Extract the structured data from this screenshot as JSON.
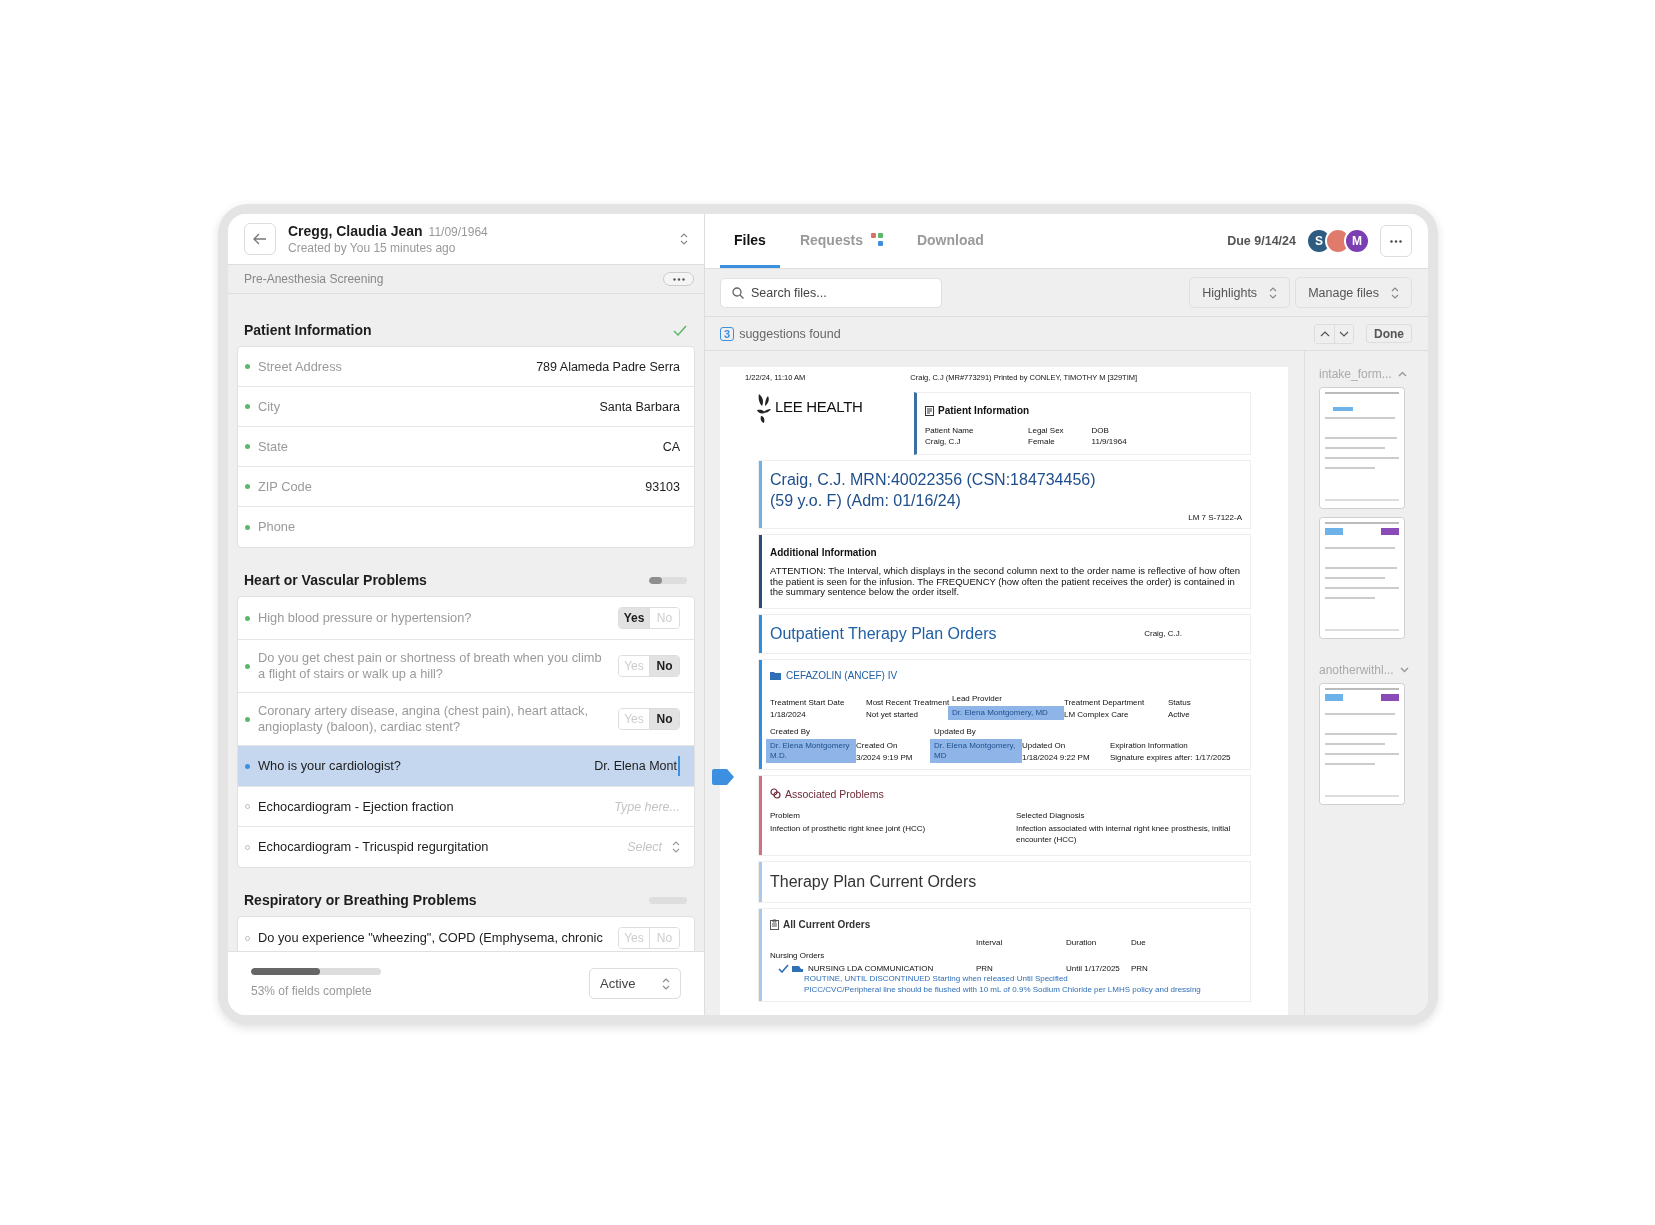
{
  "form": {
    "patient_name": "Cregg, Claudia Jean",
    "dob": "11/09/1964",
    "created": "Created by You 15 minutes ago",
    "form_name": "Pre-Anesthesia Screening",
    "sections": [
      {
        "title": "Patient Information",
        "complete": true,
        "fields": [
          {
            "kind": "text",
            "label": "Street Address",
            "value": "789 Alameda Padre Serra",
            "answered": true,
            "selected": false
          },
          {
            "kind": "text",
            "label": "City",
            "value": "Santa Barbara",
            "answered": true,
            "selected": false
          },
          {
            "kind": "text",
            "label": "State",
            "value": "CA",
            "answered": true,
            "selected": false
          },
          {
            "kind": "text",
            "label": "ZIP Code",
            "value": "93103",
            "answered": true,
            "selected": false
          },
          {
            "kind": "text",
            "label": "Phone",
            "answered": true,
            "selected": false
          }
        ]
      },
      {
        "title": "Heart or Vascular Problems",
        "complete": false,
        "level": 0.35,
        "fields": [
          {
            "kind": "yesno",
            "label": "High blood pressure or hypertension?",
            "answered": true,
            "selected": false,
            "options": [
              {
                "label": "Yes",
                "selected": true
              },
              {
                "label": "No",
                "selected": false
              }
            ]
          },
          {
            "kind": "yesno",
            "label": "Do you get chest pain or shortness of breath when you climb a flight of stairs or walk up a hill?",
            "answered": true,
            "selected": false,
            "options": [
              {
                "label": "Yes",
                "selected": false
              },
              {
                "label": "No",
                "selected": true
              }
            ]
          },
          {
            "kind": "yesno",
            "label": "Coronary artery disease, angina (chest pain), heart attack, angioplasty (baloon), cardiac stent?",
            "answered": true,
            "selected": false,
            "options": [
              {
                "label": "Yes",
                "selected": false
              },
              {
                "label": "No",
                "selected": true
              }
            ]
          },
          {
            "kind": "input",
            "label": "Who is your cardiologist?",
            "value": "Dr. Elena Mont",
            "answered": true,
            "selected": true
          },
          {
            "kind": "input",
            "label": "Echocardiogram - Ejection fraction",
            "placeholder": "Type here...",
            "answered": false,
            "selected": false
          },
          {
            "kind": "select",
            "label": "Echocardiogram - Tricuspid regurgitation",
            "placeholder": "Select",
            "answered": false,
            "selected": false
          }
        ]
      },
      {
        "title": "Respiratory or Breathing Problems",
        "complete": false,
        "fields": [
          {
            "kind": "yesno",
            "label": "Do you experience \"wheezing\", COPD (Emphysema, chronic",
            "answered": false,
            "selected": false,
            "options": [
              {
                "label": "Yes",
                "selected": false
              },
              {
                "label": "No",
                "selected": false
              }
            ]
          }
        ]
      }
    ],
    "progress": {
      "level": 0.53,
      "text": "53% of fields complete"
    },
    "status": "Active"
  },
  "tabs": [
    {
      "label": "Files",
      "selected": true
    },
    {
      "label": "Requests",
      "selected": false
    },
    {
      "label": "Download",
      "selected": false
    }
  ],
  "due": "Due 9/14/24",
  "avatars": [
    {
      "initial": "S",
      "color": "#2e5b80"
    },
    {
      "color": "#e07a6a"
    },
    {
      "initial": "M",
      "color": "#7b3fb3"
    }
  ],
  "search": {
    "placeholder": "Search files..."
  },
  "toolbar_buttons": [
    "Highlights",
    "Manage files"
  ],
  "suggestions": {
    "count": "3",
    "text": "suggestions found",
    "done": "Done"
  },
  "document": {
    "print_date": "1/22/24, 11:10 AM",
    "print_header": "Craig, C.J (MR#773291) Printed by CONLEY, TIMOTHY M [329TIM]",
    "logo": "LEE HEALTH",
    "patient_box": {
      "title": "Patient Information",
      "fields": [
        {
          "label": "Patient Name",
          "value": "Craig, C.J"
        },
        {
          "label": "Legal Sex",
          "value": "Female"
        },
        {
          "label": "DOB",
          "value": "11/9/1964"
        }
      ]
    },
    "sections": [
      {
        "kind": "banner",
        "color": "#6db3ea",
        "title": "Craig, C.J.  MRN:40022356 (CSN:184734456) (59 y.o. F) (Adm: 01/16/24)",
        "note": "LM 7 S-7122-A"
      },
      {
        "kind": "note",
        "color": "#2b4d78",
        "title": "Additional Information",
        "text": "ATTENTION:  The Interval, which displays in the second column next to the order name is reflective of how often the patient is seen for the infusion.  The FREQUENCY (how often the patient receives the order) is contained in  the summary sentence below the order itself."
      },
      {
        "kind": "heading",
        "color": "#2f8ee0",
        "title": "Outpatient Therapy Plan Orders",
        "note": "Craig, C.J."
      },
      {
        "kind": "fields",
        "color": "#2f8ee0",
        "title": "CEFAZOLIN (ANCEF) IV",
        "rows": [
          [
            {
              "label": "Treatment Start Date",
              "value": "1/18/2024",
              "highlighted": false
            },
            {
              "label": "Most Recent Treatment",
              "value": "Not yet started",
              "highlighted": false
            },
            {
              "label": "Lead Provider",
              "value": "Dr. Elena Montgomery, MD",
              "highlighted": true
            },
            {
              "label": "Treatment Department",
              "value": "LM Complex Care",
              "highlighted": false
            },
            {
              "label": "Status",
              "value": "Active",
              "highlighted": false
            }
          ],
          [
            {
              "label": "Created By",
              "value": "Dr. Elena Montgomery M.D.",
              "highlighted": true
            },
            {
              "label": "Created On",
              "value": "3/2024  9:19 PM",
              "highlighted": false
            },
            {
              "label": "Updated By",
              "value": "Dr. Elena Montgomery, MD",
              "highlighted": true
            },
            {
              "label": "Updated On",
              "value": "1/18/2024  9:22 PM",
              "highlighted": false
            },
            {
              "label": "Expiration Information",
              "value": "Signature expires after: 1/17/2025",
              "highlighted": false
            }
          ]
        ]
      },
      {
        "kind": "problems",
        "color": "#d6707e",
        "title": "Associated Problems",
        "fields": [
          {
            "label": "Problem",
            "value": "Infection of prosthetic right knee joint (HCC)"
          },
          {
            "label": "Selected Diagnosis",
            "value": "Infection associated with internal right knee prosthesis, initial encounter (HCC)"
          }
        ]
      },
      {
        "kind": "plain_heading",
        "color": "#aac8e8",
        "title": "Therapy Plan Current Orders"
      },
      {
        "kind": "orders",
        "color": "#aac8e8",
        "title": "All Current Orders",
        "columns": [
          "Interval",
          "Duration",
          "Due"
        ],
        "group": "Nursing Orders",
        "rows": [
          {
            "name": "NURSING LDA COMMUNICATION",
            "cells": [
              "PRN",
              "Until 1/17/2025",
              "PRN"
            ],
            "details": [
              "ROUTINE, UNTIL DISCONTINUED Starting when released Until Specified",
              "PICC/CVC/Peripheral line should be flushed with 10 mL of 0.9% Sodium Chloride per LMHS policy and dressing"
            ]
          }
        ]
      }
    ]
  },
  "file_groups": [
    {
      "name": "intake_form...",
      "expanded": true
    },
    {
      "name": "anotherwithl...",
      "expanded": false
    }
  ]
}
